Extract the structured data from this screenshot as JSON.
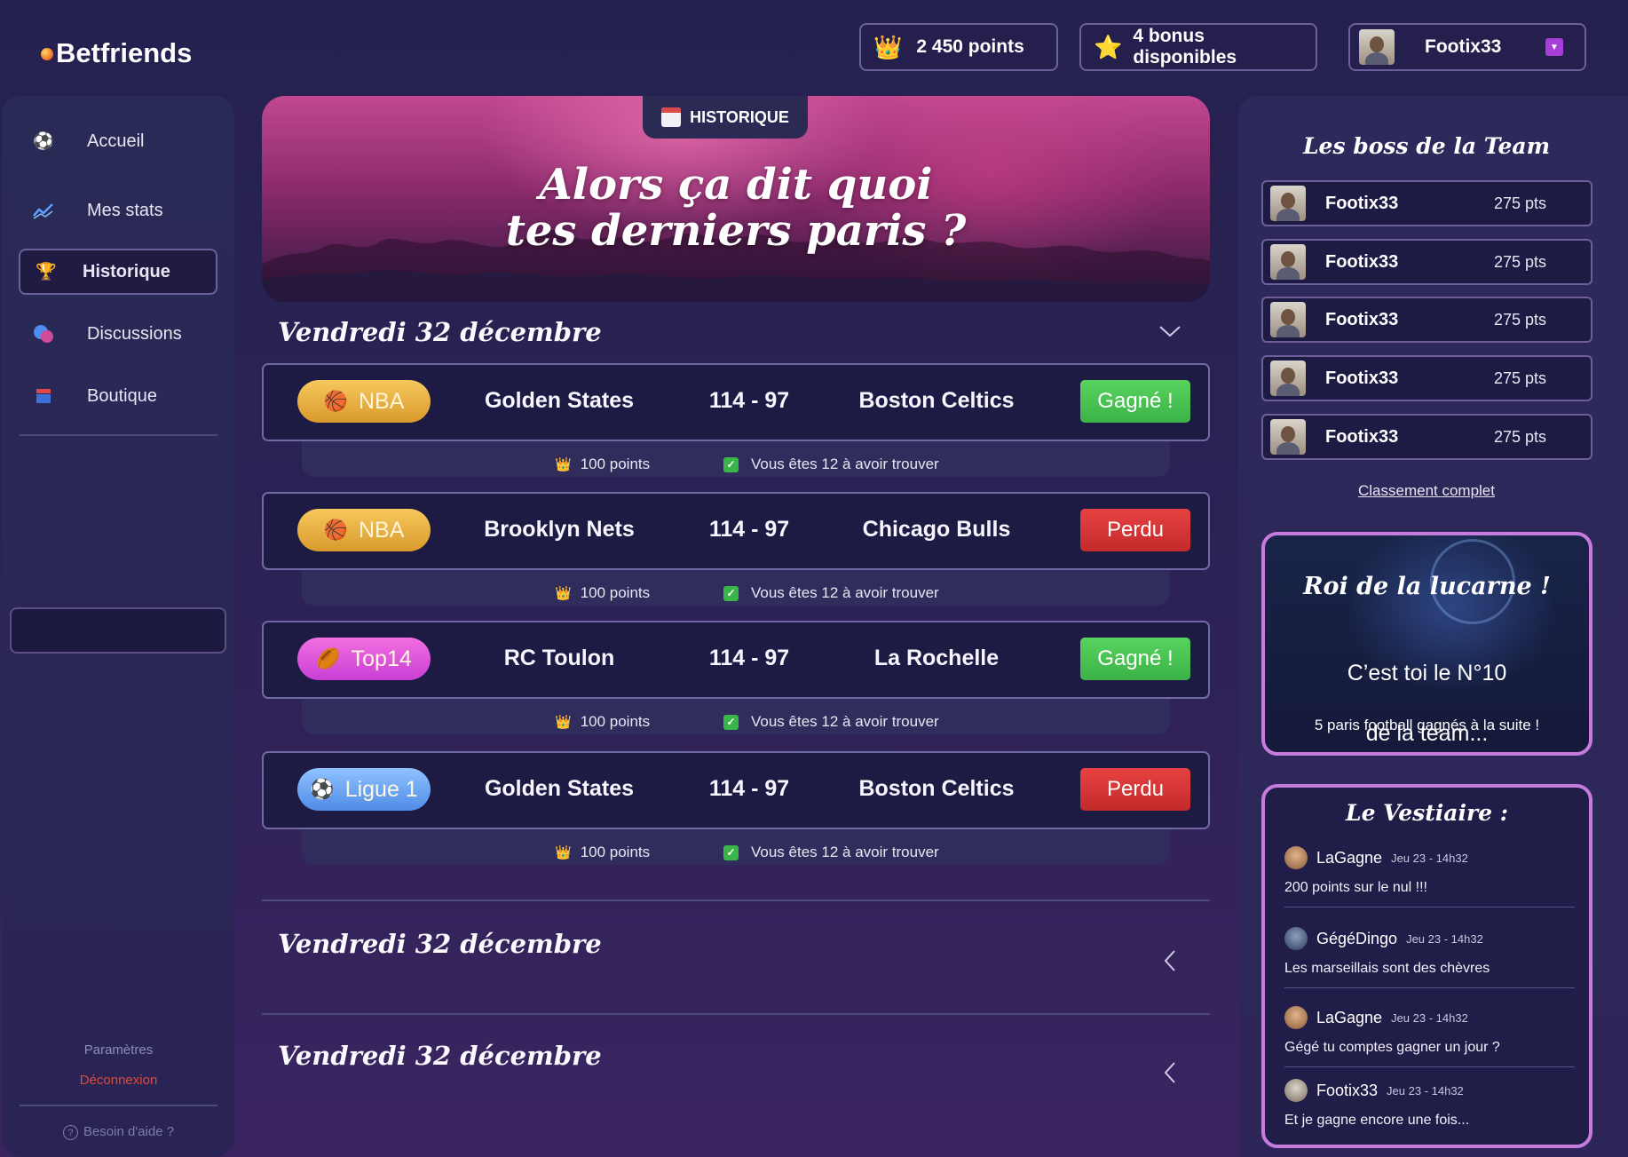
{
  "brand": {
    "name": "Betfriends"
  },
  "header": {
    "points": "2 450 points",
    "bonus": "4 bonus disponibles",
    "user": "Footix33"
  },
  "sidebar": {
    "items": [
      {
        "label": "Accueil",
        "icon": "soccer-ball-icon"
      },
      {
        "label": "Mes stats",
        "icon": "chart-icon"
      },
      {
        "label": "Historique",
        "icon": "trophy-icon",
        "active": true
      },
      {
        "label": "Discussions",
        "icon": "chat-bubbles-icon"
      },
      {
        "label": "Boutique",
        "icon": "shop-icon"
      }
    ],
    "settings": "Paramètres",
    "logout": "Déconnexion",
    "help": "Besoin d'aide ?"
  },
  "hero": {
    "tag": "HISTORIQUE",
    "title_line1": "Alors ça dit quoi",
    "title_line2": "tes derniers paris ?"
  },
  "days": [
    {
      "title": "Vendredi 32 décembre",
      "expanded": true
    },
    {
      "title": "Vendredi 32 décembre",
      "expanded": false
    },
    {
      "title": "Vendredi 32 décembre",
      "expanded": false
    }
  ],
  "matches": [
    {
      "league": "NBA",
      "league_icon": "basketball-icon",
      "home": "Golden States",
      "score": "114 - 97",
      "away": "Boston Celtics",
      "result": "Gagné !",
      "points": "100 points",
      "found": "Vous êtes 12 à avoir trouver"
    },
    {
      "league": "NBA",
      "league_icon": "basketball-icon",
      "home": "Brooklyn Nets",
      "score": "114 - 97",
      "away": "Chicago Bulls",
      "result": "Perdu",
      "points": "100 points",
      "found": "Vous êtes 12 à avoir trouver"
    },
    {
      "league": "Top14",
      "league_icon": "rugby-ball-icon",
      "home": "RC Toulon",
      "score": "114 - 97",
      "away": "La Rochelle",
      "result": "Gagné !",
      "points": "100 points",
      "found": "Vous êtes 12 à avoir trouver"
    },
    {
      "league": "Ligue 1",
      "league_icon": "soccer-ball-icon",
      "home": "Golden States",
      "score": "114 - 97",
      "away": "Boston Celtics",
      "result": "Perdu",
      "points": "100 points",
      "found": "Vous êtes 12 à avoir trouver"
    }
  ],
  "bosses": {
    "title": "Les boss de la Team",
    "list": [
      {
        "name": "Footix33",
        "pts": "275 pts"
      },
      {
        "name": "Footix33",
        "pts": "275 pts"
      },
      {
        "name": "Footix33",
        "pts": "275 pts"
      },
      {
        "name": "Footix33",
        "pts": "275 pts"
      },
      {
        "name": "Footix33",
        "pts": "275 pts"
      }
    ],
    "link": "Classement complet"
  },
  "roi": {
    "title": "Roi de la lucarne !",
    "line1": "C’est toi le N°10",
    "line2": "de la team...",
    "footer": "5 paris football gagnés à la suite !"
  },
  "vestiaire": {
    "title": "Le Vestiaire :",
    "messages": [
      {
        "author": "LaGagne",
        "time": "Jeu 23 - 14h32",
        "text": "200 points sur le nul !!!"
      },
      {
        "author": "GégéDingo",
        "time": "Jeu 23 - 14h32",
        "text": "Les marseillais sont des chèvres"
      },
      {
        "author": "LaGagne",
        "time": "Jeu 23 - 14h32",
        "text": "Gégé tu comptes gagner un jour ?"
      },
      {
        "author": "Footix33",
        "time": "Jeu 23 - 14h32",
        "text": "Et je gagne encore une fois..."
      }
    ]
  },
  "colors": {
    "background": "#272252",
    "win": "#4cc553",
    "lose": "#d83535",
    "accent": "#c77bdf"
  }
}
